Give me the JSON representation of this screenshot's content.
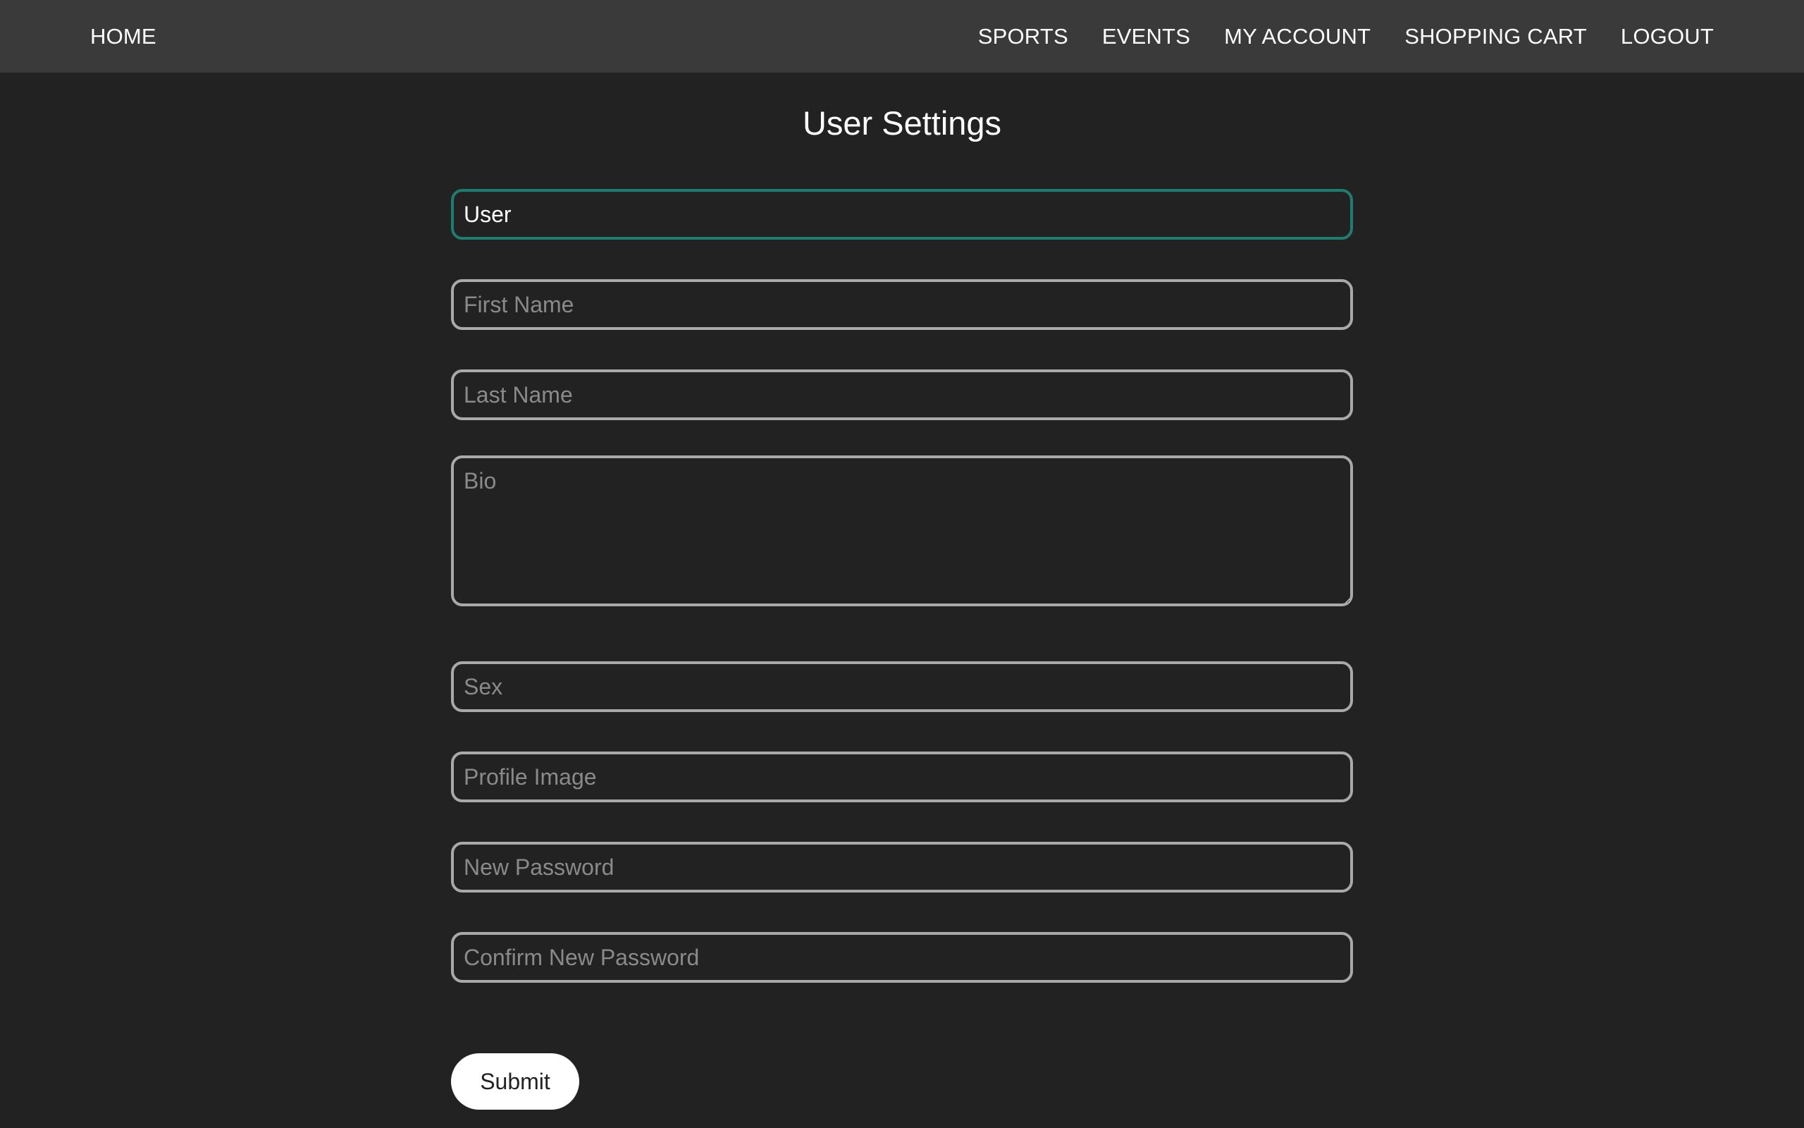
{
  "nav": {
    "home": "HOME",
    "items": [
      "SPORTS",
      "EVENTS",
      "MY ACCOUNT",
      "SHOPPING CART",
      "LOGOUT"
    ]
  },
  "page": {
    "title": "User Settings"
  },
  "form": {
    "username": {
      "value": "User",
      "placeholder": ""
    },
    "first_name": {
      "value": "",
      "placeholder": "First Name"
    },
    "last_name": {
      "value": "",
      "placeholder": "Last Name"
    },
    "bio": {
      "value": "",
      "placeholder": "Bio"
    },
    "sex": {
      "value": "",
      "placeholder": "Sex"
    },
    "profile_image": {
      "value": "",
      "placeholder": "Profile Image"
    },
    "new_password": {
      "value": "",
      "placeholder": "New Password"
    },
    "confirm_password": {
      "value": "",
      "placeholder": "Confirm New Password"
    },
    "submit_label": "Submit"
  },
  "colors": {
    "background": "#222222",
    "navbar": "#3a3a3a",
    "field_border": "#a9a9a9",
    "focus_border": "#1f7c70"
  }
}
